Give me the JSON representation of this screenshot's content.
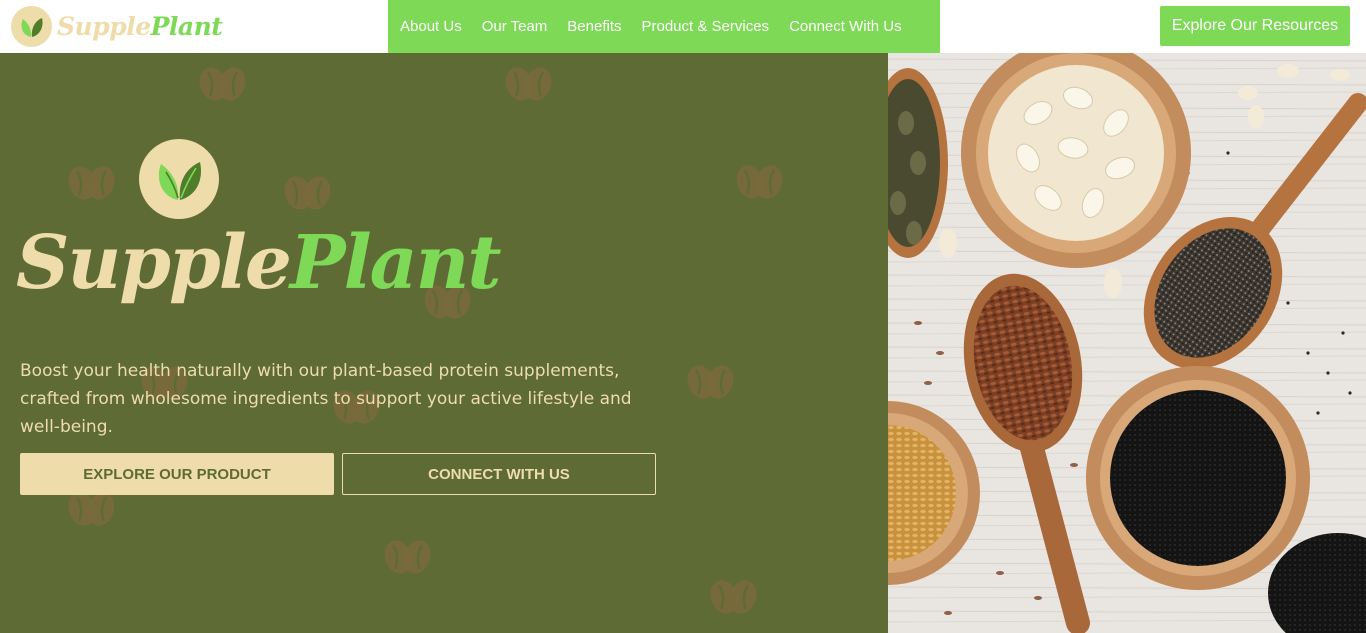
{
  "header": {
    "logo": {
      "part1": "Supple",
      "part2": "Plant"
    },
    "nav": [
      {
        "label": "About Us"
      },
      {
        "label": "Our Team"
      },
      {
        "label": "Benefits"
      },
      {
        "label": "Product & Services"
      },
      {
        "label": "Connect With Us"
      }
    ],
    "cta_label": "Explore Our Resources"
  },
  "hero": {
    "title_part1": "Supple",
    "title_part2": "Plant",
    "description": "Boost your health naturally with our plant-based protein supplements, crafted from wholesome ingredients to support your active lifestyle and well-being.",
    "primary_button": "EXPLORE OUR PRODUCT",
    "secondary_button": "CONNECT WITH US"
  },
  "colors": {
    "brand_green": "#7ed957",
    "olive": "#5e6b35",
    "cream": "#efdcab",
    "bean_brown": "#7a6a3c"
  },
  "icons": {
    "logo": "leaf-icon",
    "background_pattern": "coffee-bean-icon",
    "photo": "seeds-in-wooden-bowls-photo"
  }
}
